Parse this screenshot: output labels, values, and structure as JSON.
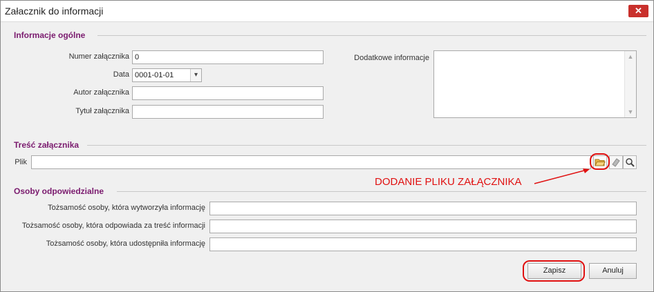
{
  "window": {
    "title": "Załacznik do informacji",
    "close_glyph": "✕"
  },
  "general": {
    "title": "Informacje ogólne",
    "number_label": "Numer załącznika",
    "number_value": "0",
    "date_label": "Data",
    "date_value": "0001-01-01",
    "author_label": "Autor załącznika",
    "author_value": "",
    "doc_title_label": "Tytuł załącznika",
    "doc_title_value": "",
    "extra_label": "Dodatkowe informacje",
    "extra_value": ""
  },
  "content": {
    "title": "Treść załącznika",
    "file_label": "Plik",
    "file_value": "",
    "icons": [
      "folder-open-icon",
      "eraser-icon",
      "magnifier-icon"
    ]
  },
  "annotation": {
    "text": "DODANIE PLIKU ZAŁĄCZNIKA",
    "color": "#e01010"
  },
  "people": {
    "title": "Osoby odpowiedzialne",
    "produced_label": "Tożsamość osoby, która wytworzyła informację",
    "produced_value": "",
    "responsible_label": "Tożsamość osoby, która odpowiada za treść informacji",
    "responsible_value": "",
    "shared_label": "Tożsamość osoby, która udostępniła informację",
    "shared_value": ""
  },
  "buttons": {
    "save": "Zapisz",
    "cancel": "Anuluj"
  },
  "colors": {
    "section_title": "#7a1a6e",
    "close_button": "#c9302c"
  }
}
